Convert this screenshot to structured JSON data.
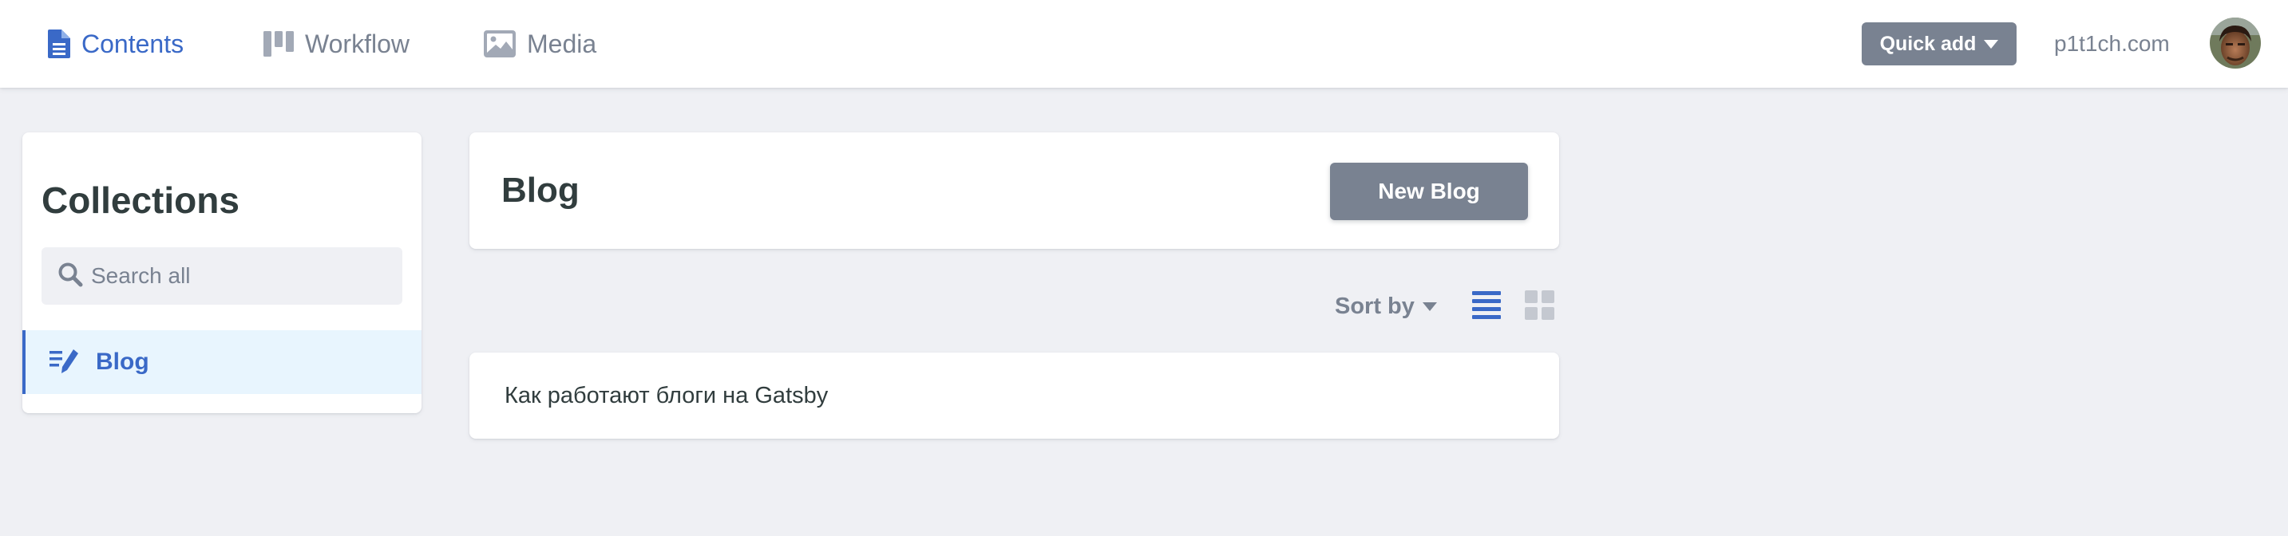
{
  "topbar": {
    "nav": [
      {
        "label": "Contents",
        "icon": "document-icon",
        "active": true
      },
      {
        "label": "Workflow",
        "icon": "kanban-icon",
        "active": false
      },
      {
        "label": "Media",
        "icon": "image-icon",
        "active": false
      }
    ],
    "quick_add_label": "Quick add",
    "site_label": "p1t1ch.com",
    "avatar": "user-avatar"
  },
  "sidebar": {
    "title": "Collections",
    "search_placeholder": "Search all",
    "collections": [
      {
        "label": "Blog",
        "icon": "pencil-lines-icon",
        "active": true
      }
    ]
  },
  "main": {
    "title": "Blog",
    "new_button_label": "New Blog",
    "sort_label": "Sort by",
    "view_modes": [
      "list-view-icon",
      "grid-view-icon"
    ],
    "active_view": "list",
    "entries": [
      {
        "title": "Как работают блоги на Gatsby"
      }
    ]
  },
  "colors": {
    "accent": "#3a69c7",
    "muted": "#798291",
    "text": "#313d3e",
    "background": "#eff0f4",
    "selected_bg": "#e8f5fe"
  }
}
